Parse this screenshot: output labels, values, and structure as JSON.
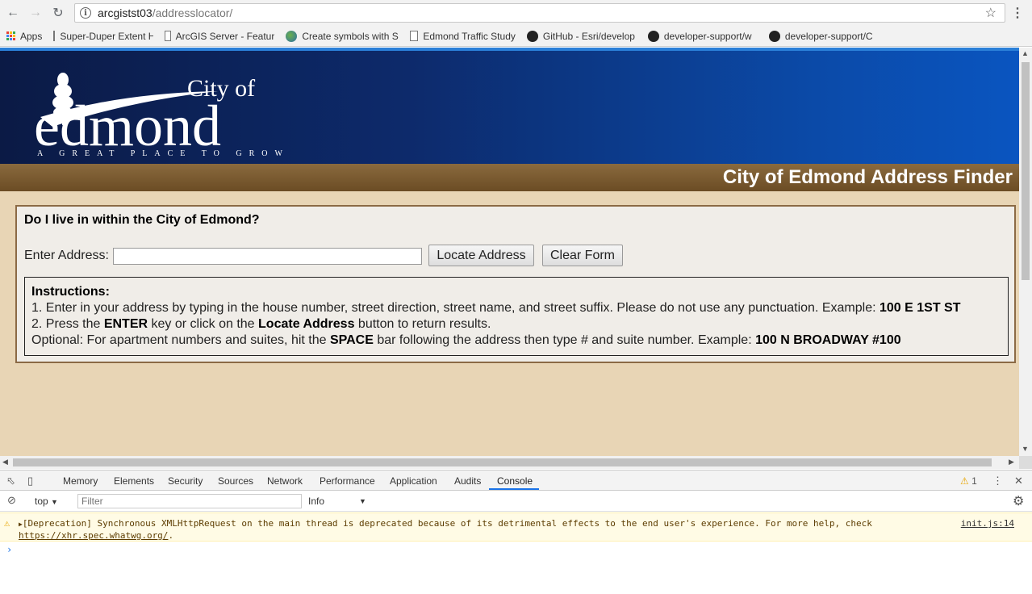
{
  "browser": {
    "url_host": "arcgistst03",
    "url_path": "/addresslocator/",
    "bookmarks": [
      {
        "label": "Apps"
      },
      {
        "label": "Super-Duper Extent H"
      },
      {
        "label": "ArcGIS Server - Featur"
      },
      {
        "label": "Create symbols with S"
      },
      {
        "label": "Edmond Traffic Study"
      },
      {
        "label": "GitHub - Esri/develop"
      },
      {
        "label": "developer-support/w"
      },
      {
        "label": "developer-support/C"
      }
    ]
  },
  "logo": {
    "line1": "City of",
    "line2": "edmond",
    "tagline": "A GREAT PLACE TO GROW"
  },
  "page": {
    "title": "City of Edmond Address Finder",
    "question": "Do I live in within the City of Edmond?",
    "address_label": "Enter Address:",
    "address_value": "",
    "locate_button": "Locate Address",
    "clear_button": "Clear Form",
    "instructions": {
      "heading": "Instructions:",
      "line1_text": "1. Enter in your address by typing in the house number, street direction, street name, and street suffix. Please do not use any punctuation. Example: ",
      "line1_example": "100 E 1ST ST",
      "line2_a": "2. Press the ",
      "line2_enter": "ENTER",
      "line2_b": " key or click on the ",
      "line2_locate": "Locate Address",
      "line2_c": " button to return results.",
      "line3_a": "Optional: For apartment numbers and suites, hit the ",
      "line3_space": "SPACE",
      "line3_b": " bar following the address then type # and suite number. Example: ",
      "line3_example": "100 N BROADWAY #100"
    }
  },
  "devtools": {
    "tabs": [
      "Memory",
      "Elements",
      "Security",
      "Sources",
      "Network",
      "Performance",
      "Application",
      "Audits",
      "Console"
    ],
    "active_tab": "Console",
    "warning_count": "1",
    "context": "top",
    "filter_placeholder": "Filter",
    "level": "Info",
    "message_text": "[Deprecation] Synchronous XMLHttpRequest on the main thread is deprecated because of its detrimental effects to the end user's experience. For more help, check ",
    "message_link": "https://xhr.spec.whatwg.org/",
    "message_end": ".",
    "message_source": "init.js:14",
    "prompt": "›"
  },
  "colors": {
    "header_dark": "#0b1a45",
    "header_blue": "#0a55c0",
    "title_bar": "#6b4c24",
    "page_bg": "#e8d5b5",
    "panel_border": "#8b6a45"
  }
}
